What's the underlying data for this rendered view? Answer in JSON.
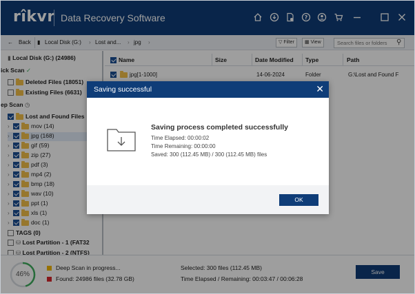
{
  "app": {
    "logo": "rîkvr",
    "title": "Data Recovery Software"
  },
  "titlebar_icons": [
    "home-icon",
    "download-icon",
    "document-icon",
    "help-icon",
    "user-icon",
    "cart-icon",
    "minimize-icon",
    "maximize-icon",
    "close-icon"
  ],
  "nav": {
    "back": "Back",
    "crumbs": [
      "Local Disk (G:)",
      "Lost and...",
      "jpg"
    ],
    "filter": "Filter",
    "view": "View",
    "search_placeholder": "Search files or folders"
  },
  "tree": {
    "disk": "Local Disk (G:) (24986)",
    "quick_scan": "ick Scan",
    "deleted_files": "Deleted Files (18051)",
    "existing_files": "Existing Files (6631)",
    "deep_scan": "ep Scan",
    "lost_found": "Lost and Found Files",
    "folders": [
      {
        "label": "mov (14)"
      },
      {
        "label": "jpg (168)"
      },
      {
        "label": "gif (59)"
      },
      {
        "label": "zip (27)"
      },
      {
        "label": "pdf (3)"
      },
      {
        "label": "mp4 (2)"
      },
      {
        "label": "bmp (18)"
      },
      {
        "label": "wav (10)"
      },
      {
        "label": "ppt (1)"
      },
      {
        "label": "xls (1)"
      },
      {
        "label": "doc (1)"
      }
    ],
    "tags": "TAGS (0)",
    "lost_partition": "Lost Partition - 1 (FAT32",
    "lost_partition2": "Lost Partition - 2 (NTFS)"
  },
  "table": {
    "headers": [
      "Name",
      "Size",
      "Date Modified",
      "Type",
      "Path"
    ],
    "row": {
      "name": "jpg[1-1000]",
      "size": "",
      "date": "14-06-2024",
      "type": "Folder",
      "path": "G:\\Lost and Found F"
    }
  },
  "dialog": {
    "title": "Saving successful",
    "heading": "Saving process completed successfully",
    "elapsed": "Time Elapsed: 00:00:02",
    "remaining": "Time Remaining: 00:00:00",
    "saved": "Saved: 300 (112.45 MB) / 300 (112.45 MB) files",
    "ok": "OK"
  },
  "status": {
    "percent": "46%",
    "progress_fraction": 0.46,
    "scan_label": "Deep Scan in progress...",
    "found": "Found: 24986 files (32.78 GB)",
    "selected": "Selected: 300 files (112.45 MB)",
    "time": "Time Elapsed / Remaining: 00:03:47 / 00:06:28",
    "save": "Save"
  },
  "colors": {
    "brand": "#0f3d78",
    "pause": "#f2b600",
    "stop": "#d9262c",
    "folder": "#f4c04a",
    "progress": "#3fae5e"
  }
}
